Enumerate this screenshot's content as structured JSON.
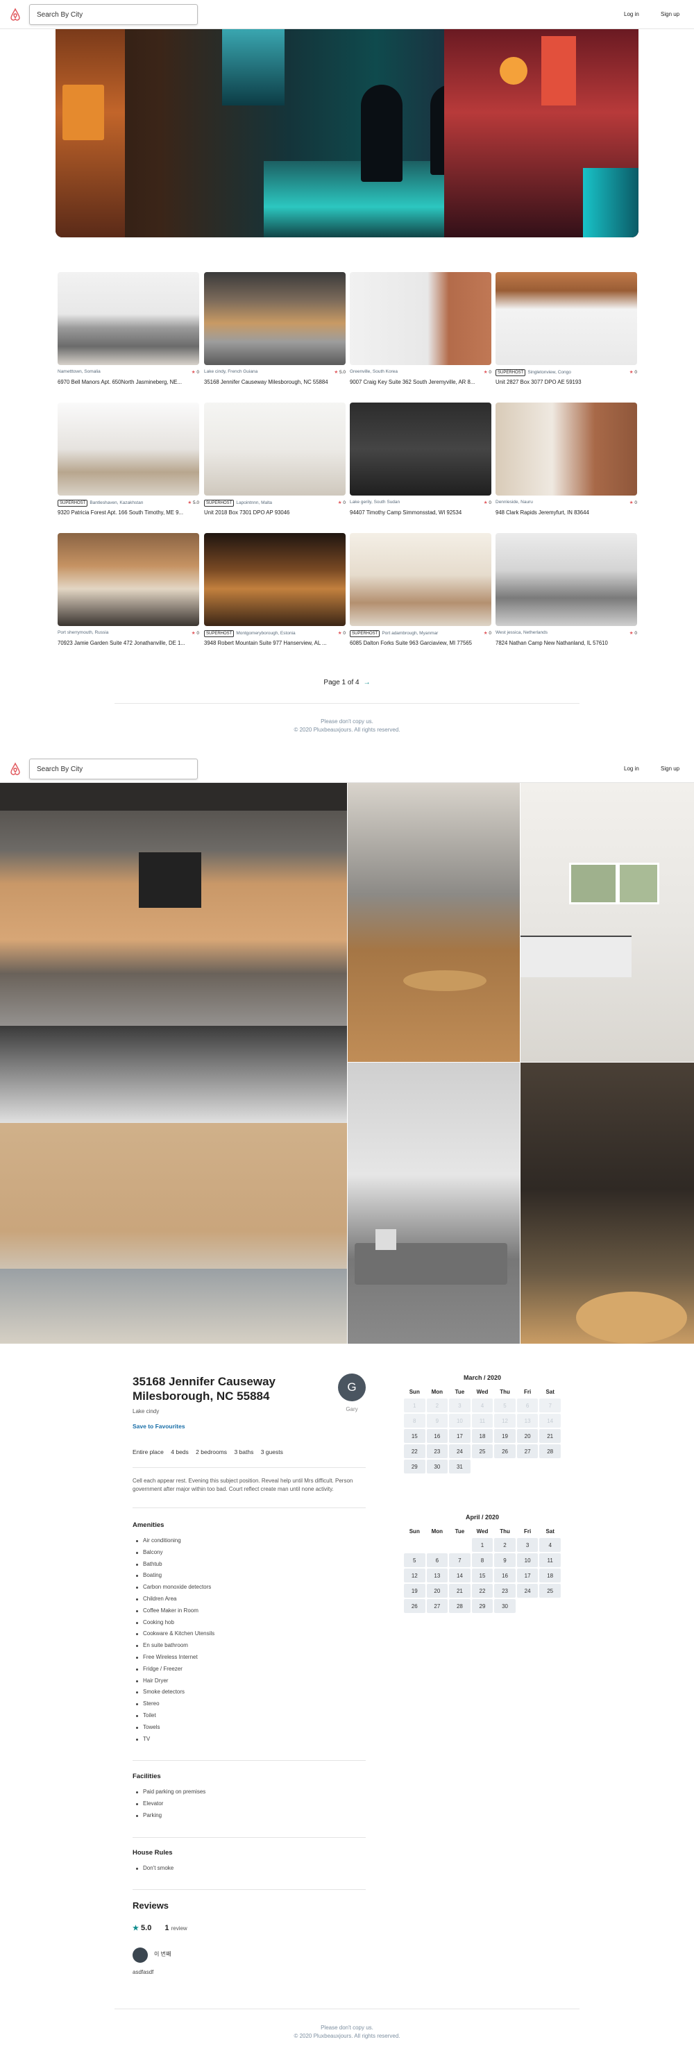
{
  "nav": {
    "search_placeholder": "Search By City",
    "login": "Log in",
    "signup": "Sign up"
  },
  "listings": [
    {
      "location": "Nametttown, Somalia",
      "superhost": false,
      "rating": "0",
      "address": "6970 Bell Manors Apt. 650North Jasmineberg, NE..."
    },
    {
      "location": "Lake cindy, French Guiana",
      "superhost": false,
      "rating": "5.0",
      "address": "35168 Jennifer Causeway Milesborough, NC 55884"
    },
    {
      "location": "Greenville, South Korea",
      "superhost": false,
      "rating": "0",
      "address": "9007 Craig Key Suite 362 South Jeremyville, AR 8..."
    },
    {
      "location": "Singletonview, Congo",
      "superhost": true,
      "rating": "0",
      "address": "Unit 2827 Box 3077 DPO AE 59193"
    },
    {
      "location": "Bantleshaven, Kazakhstan",
      "superhost": true,
      "rating": "5.0",
      "address": "9320 Patricia Forest Apt. 166 South Timothy, ME 9..."
    },
    {
      "location": "Lapointnnn, Malta",
      "superhost": true,
      "rating": "0",
      "address": "Unit 2018 Box 7301 DPO AP 93046"
    },
    {
      "location": "Lake gerily, South Sudan",
      "superhost": false,
      "rating": "0",
      "address": "94407 Timothy Camp Simmonsstad, WI 92534"
    },
    {
      "location": "Dennleside, Nauru",
      "superhost": false,
      "rating": "0",
      "address": "948 Clark Rapids Jeremyfurt, IN 83644"
    },
    {
      "location": "Port sherrymouth, Russia",
      "superhost": false,
      "rating": "0",
      "address": "70923 Jamie Garden Suite 472 Jonathanville, DE 1..."
    },
    {
      "location": "Montgomeryborough, Estonia",
      "superhost": true,
      "rating": "0",
      "address": "3948 Robert Mountain Suite 977 Hanserview, AL ..."
    },
    {
      "location": "Port adambrough, Myanmar",
      "superhost": true,
      "rating": "0",
      "address": "6085 Dalton Forks Suite 963 Garciaview, MI 77565"
    },
    {
      "location": "West jessica, Netherlands",
      "superhost": false,
      "rating": "0",
      "address": "7824 Nathan Camp New Nathanland, IL 57610"
    }
  ],
  "superhost_label": "SUPERHOST",
  "pager": {
    "text": "Page 1 of 4"
  },
  "footer": {
    "line1": "Please don't copy us.",
    "line2": "© 2020 Pluxbeauxjours. All rights reserved."
  },
  "detail": {
    "title": "35168 Jennifer Causeway Milesborough, NC 55884",
    "city": "Lake cindy",
    "favourite": "Save to Favourites",
    "host_initial": "G",
    "host_name": "Gary",
    "stats": [
      "Entire place",
      "4 beds",
      "2 bedrooms",
      "3 baths",
      "3 guests"
    ],
    "description": "Cell each appear rest. Evening this subject position. Reveal help until Mrs difficult. Person government after major within too bad. Court reflect create man until none activity.",
    "amenities_title": "Amenities",
    "amenities": [
      "Air conditioning",
      "Balcony",
      "Bathtub",
      "Boating",
      "Carbon monoxide detectors",
      "Children Area",
      "Coffee Maker in Room",
      "Cooking hob",
      "Cookware & Kitchen Utensils",
      "En suite bathroom",
      "Free Wireless Internet",
      "Fridge / Freezer",
      "Hair Dryer",
      "Smoke detectors",
      "Stereo",
      "Toilet",
      "Towels",
      "TV"
    ],
    "facilities_title": "Facilities",
    "facilities": [
      "Paid parking on premises",
      "Elevator",
      "Parking"
    ],
    "rules_title": "House Rules",
    "rules": [
      "Don't smoke"
    ],
    "reviews_title": "Reviews",
    "review_score": "5.0",
    "review_count": "1",
    "review_count_label": "review",
    "reviewer": "이 번째",
    "review_text": "asdfasdf"
  },
  "calendar": {
    "weekdays": [
      "Sun",
      "Mon",
      "Tue",
      "Wed",
      "Thu",
      "Fri",
      "Sat"
    ],
    "months": [
      {
        "name": "March / 2020",
        "start": 0,
        "days": 31,
        "past_until": 14
      },
      {
        "name": "April / 2020",
        "start": 3,
        "days": 30,
        "past_until": 0
      }
    ]
  },
  "colors": {
    "accent": "#e0565b",
    "link": "#1a6fa8",
    "teal": "#0a8a8a"
  }
}
